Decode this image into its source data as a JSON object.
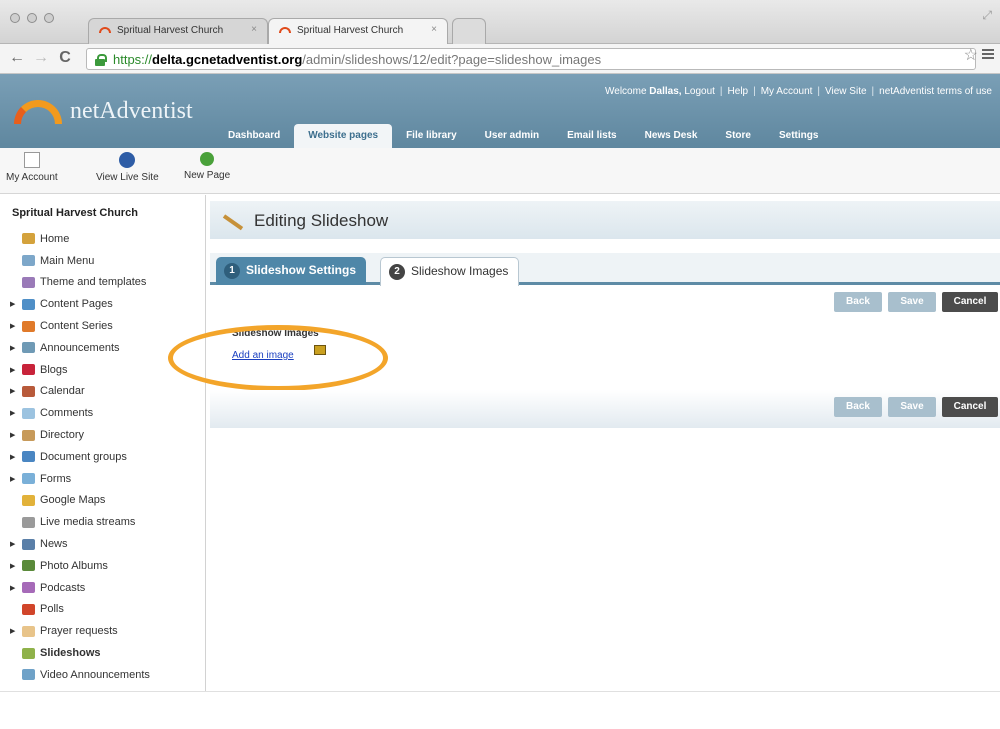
{
  "browser": {
    "tabs": [
      {
        "title": "Spritual Harvest Church",
        "close": "×"
      },
      {
        "title": "Spritual Harvest Church",
        "close": "×"
      }
    ],
    "url": {
      "scheme": "https://",
      "host": "delta.gcnetadventist.org",
      "path": "/admin/slideshows/12/edit?page=slideshow_images"
    },
    "nav": {
      "back": "←",
      "forward": "→",
      "reload": "C"
    }
  },
  "header": {
    "logo_text": "netAdventist",
    "user_links": {
      "welcome_prefix": "Welcome",
      "user": "Dallas,",
      "links": [
        "Logout",
        "Help",
        "My Account",
        "View Site",
        "netAdventist terms of use"
      ]
    },
    "nav": [
      "Dashboard",
      "Website pages",
      "File library",
      "User admin",
      "Email lists",
      "News Desk",
      "Store",
      "Settings"
    ],
    "active_nav": "Website pages"
  },
  "tools": [
    "My Account",
    "View Live Site",
    "New Page"
  ],
  "sidebar": {
    "site_title": "Spritual Harvest Church",
    "items": [
      {
        "label": "Home",
        "icon": "home-icon",
        "color": "#d4a23c",
        "expandable": false
      },
      {
        "label": "Main Menu",
        "icon": "menu-icon",
        "color": "#7da7c9",
        "expandable": false
      },
      {
        "label": "Theme and templates",
        "icon": "theme-icon",
        "color": "#9a7ab8",
        "expandable": false
      },
      {
        "label": "Content Pages",
        "icon": "content-pages-icon",
        "color": "#4f8fc7",
        "expandable": true
      },
      {
        "label": "Content Series",
        "icon": "content-series-icon",
        "color": "#e07a2a",
        "expandable": true
      },
      {
        "label": "Announcements",
        "icon": "announcements-icon",
        "color": "#6f9ab5",
        "expandable": true
      },
      {
        "label": "Blogs",
        "icon": "blogs-icon",
        "color": "#c8233a",
        "expandable": true
      },
      {
        "label": "Calendar",
        "icon": "calendar-icon",
        "color": "#b85a3a",
        "expandable": true
      },
      {
        "label": "Comments",
        "icon": "comments-icon",
        "color": "#9cc3e0",
        "expandable": true
      },
      {
        "label": "Directory",
        "icon": "directory-icon",
        "color": "#c79a5a",
        "expandable": true
      },
      {
        "label": "Document groups",
        "icon": "document-groups-icon",
        "color": "#4a86c2",
        "expandable": true
      },
      {
        "label": "Forms",
        "icon": "forms-icon",
        "color": "#7ab0d8",
        "expandable": true
      },
      {
        "label": "Google Maps",
        "icon": "google-maps-icon",
        "color": "#e2b23a",
        "expandable": false
      },
      {
        "label": "Live media streams",
        "icon": "live-media-icon",
        "color": "#9a9a9a",
        "expandable": false
      },
      {
        "label": "News",
        "icon": "news-icon",
        "color": "#5a7fa8",
        "expandable": true
      },
      {
        "label": "Photo Albums",
        "icon": "photo-albums-icon",
        "color": "#5a8a3a",
        "expandable": true
      },
      {
        "label": "Podcasts",
        "icon": "podcasts-icon",
        "color": "#a66ab8",
        "expandable": true
      },
      {
        "label": "Polls",
        "icon": "polls-icon",
        "color": "#d1452a",
        "expandable": false
      },
      {
        "label": "Prayer requests",
        "icon": "prayer-requests-icon",
        "color": "#e8c48a",
        "expandable": true
      },
      {
        "label": "Slideshows",
        "icon": "slideshows-icon",
        "color": "#8fb24a",
        "expandable": false,
        "active": true
      },
      {
        "label": "Video Announcements",
        "icon": "video-announcements-icon",
        "color": "#6fa2c8",
        "expandable": false
      }
    ]
  },
  "main": {
    "title": "Editing Slideshow",
    "tabs": [
      {
        "num": "1",
        "label": "Slideshow Settings"
      },
      {
        "num": "2",
        "label": "Slideshow Images"
      }
    ],
    "buttons": {
      "back": "Back",
      "save": "Save",
      "cancel": "Cancel"
    },
    "section_label": "Slideshow Images",
    "add_link": "Add an image"
  },
  "colors": {
    "accent": "#5e8ba6",
    "highlight": "#f3a52a",
    "link": "#1a3fc0"
  }
}
